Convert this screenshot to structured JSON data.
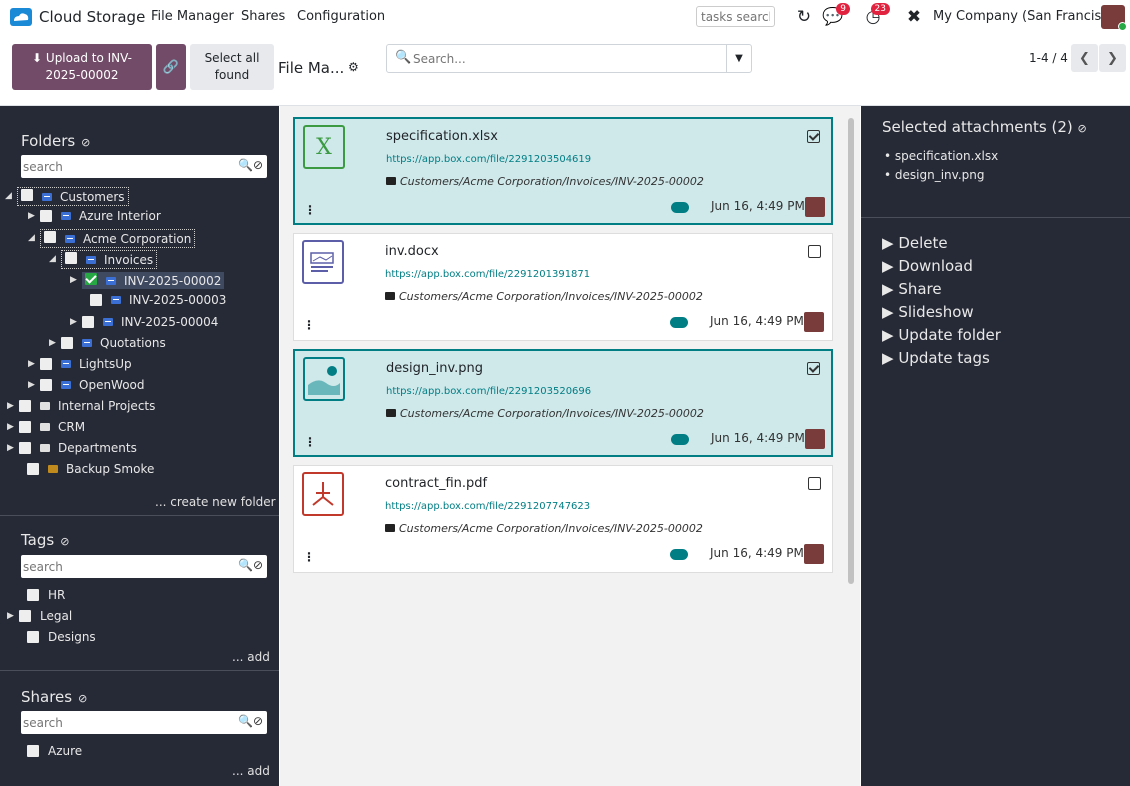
{
  "navbar": {
    "app_title": "Cloud Storage",
    "menu": [
      "File Manager",
      "Shares",
      "Configuration"
    ],
    "tasks_search_placeholder": "tasks search",
    "messages_badge": "9",
    "activity_badge": "23",
    "company": "My Company (San Francisco)"
  },
  "control": {
    "upload_label_1": "Upload to INV-",
    "upload_label_2": "2025-00002",
    "select_all_1": "Select all",
    "select_all_2": "found",
    "breadcrumb": "File Ma...",
    "search_placeholder": "Search...",
    "pager": "1-4 / 4"
  },
  "folders": {
    "title": "Folders",
    "search_placeholder": "search",
    "items": [
      {
        "label": "Customers"
      },
      {
        "label": "Azure Interior"
      },
      {
        "label": "Acme Corporation"
      },
      {
        "label": "Invoices"
      },
      {
        "label": "INV-2025-00002"
      },
      {
        "label": "INV-2025-00003"
      },
      {
        "label": "INV-2025-00004"
      },
      {
        "label": "Quotations"
      },
      {
        "label": "LightsUp"
      },
      {
        "label": "OpenWood"
      },
      {
        "label": "Internal Projects"
      },
      {
        "label": "CRM"
      },
      {
        "label": "Departments"
      },
      {
        "label": "Backup Smoke"
      }
    ],
    "create_link": "... create new folder"
  },
  "tags": {
    "title": "Tags",
    "search_placeholder": "search",
    "items": [
      "HR",
      "Legal",
      "Designs"
    ],
    "add_link": "... add"
  },
  "shares": {
    "title": "Shares",
    "search_placeholder": "search",
    "items": [
      "Azure"
    ],
    "add_link": "... add"
  },
  "attachments": [
    {
      "name": "specification.xlsx",
      "url": "https://app.box.com/file/2291203504619",
      "path": "Customers/Acme Corporation/Invoices/INV-2025-00002",
      "date": "Jun 16, 4:49 PM",
      "selected": true,
      "icon": "spreadsheet-icon",
      "glyph": "X",
      "color": "#3c9b42"
    },
    {
      "name": "inv.docx",
      "url": "https://app.box.com/file/2291201391871",
      "path": "Customers/Acme Corporation/Invoices/INV-2025-00002",
      "date": "Jun 16, 4:49 PM",
      "selected": false,
      "icon": "document-icon",
      "glyph": "",
      "color": "#5c5fa8"
    },
    {
      "name": "design_inv.png",
      "url": "https://app.box.com/file/2291203520696",
      "path": "Customers/Acme Corporation/Invoices/INV-2025-00002",
      "date": "Jun 16, 4:49 PM",
      "selected": true,
      "icon": "image-icon",
      "glyph": "",
      "color": "#017e84"
    },
    {
      "name": "contract_fin.pdf",
      "url": "https://app.box.com/file/2291207747623",
      "path": "Customers/Acme Corporation/Invoices/INV-2025-00002",
      "date": "Jun 16, 4:49 PM",
      "selected": false,
      "icon": "pdf-icon",
      "glyph": "",
      "color": "#c0392b"
    }
  ],
  "selection": {
    "title": "Selected attachments (2)",
    "items": [
      "specification.xlsx",
      "design_inv.png"
    ],
    "actions": [
      "Delete",
      "Download",
      "Share",
      "Slideshow",
      "Update folder",
      "Update tags"
    ]
  }
}
